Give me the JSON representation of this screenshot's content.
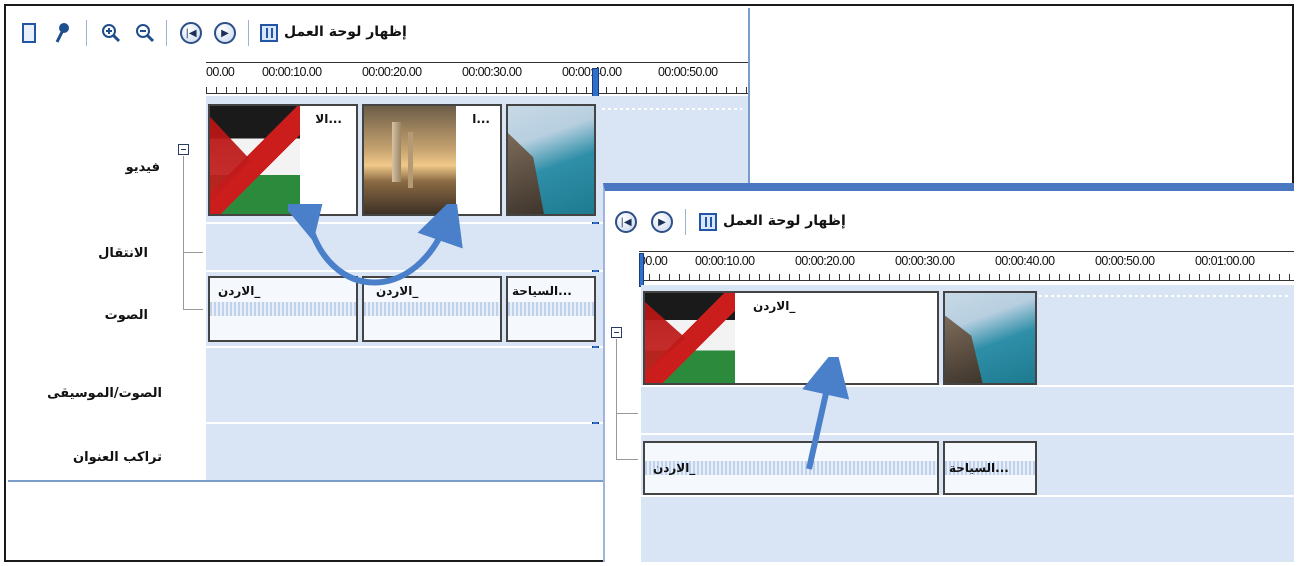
{
  "panelA": {
    "toolbar": {
      "show_storyboard_label": "إظهار لوحة العمل"
    },
    "ruler_ticks": [
      "00.00",
      "00:00:10.00",
      "00:00:20.00",
      "00:00:30.00",
      "00:00:40.00",
      "00:00:50.00"
    ],
    "track_labels": {
      "video": "فيديو",
      "transition": "الانتقال",
      "audio": "الصوت",
      "music": "الصوت/الموسيقى",
      "title": "تراكب العنوان"
    },
    "video_clips": [
      {
        "caption": "...الا"
      },
      {
        "caption": "...ا"
      },
      {
        "caption": ""
      }
    ],
    "audio_clips": [
      {
        "caption": "_الاردن"
      },
      {
        "caption": "_الاردن"
      },
      {
        "caption": "...السياحة"
      }
    ]
  },
  "panelB": {
    "toolbar": {
      "show_storyboard_label": "إظهار لوحة العمل"
    },
    "ruler_ticks": [
      "00.00",
      "00:00:10.00",
      "00:00:20.00",
      "00:00:30.00",
      "00:00:40.00",
      "00:00:50.00",
      "00:01:00.00"
    ],
    "video_clips": [
      {
        "caption": "_الاردن"
      },
      {
        "caption": ""
      }
    ],
    "audio_clips": [
      {
        "caption": "_الاردن"
      },
      {
        "caption": "...السياحة"
      }
    ]
  },
  "colors": {
    "track_bg": "#d9e5f4",
    "accent": "#2f6fce",
    "arrow": "#4a7fc9"
  }
}
